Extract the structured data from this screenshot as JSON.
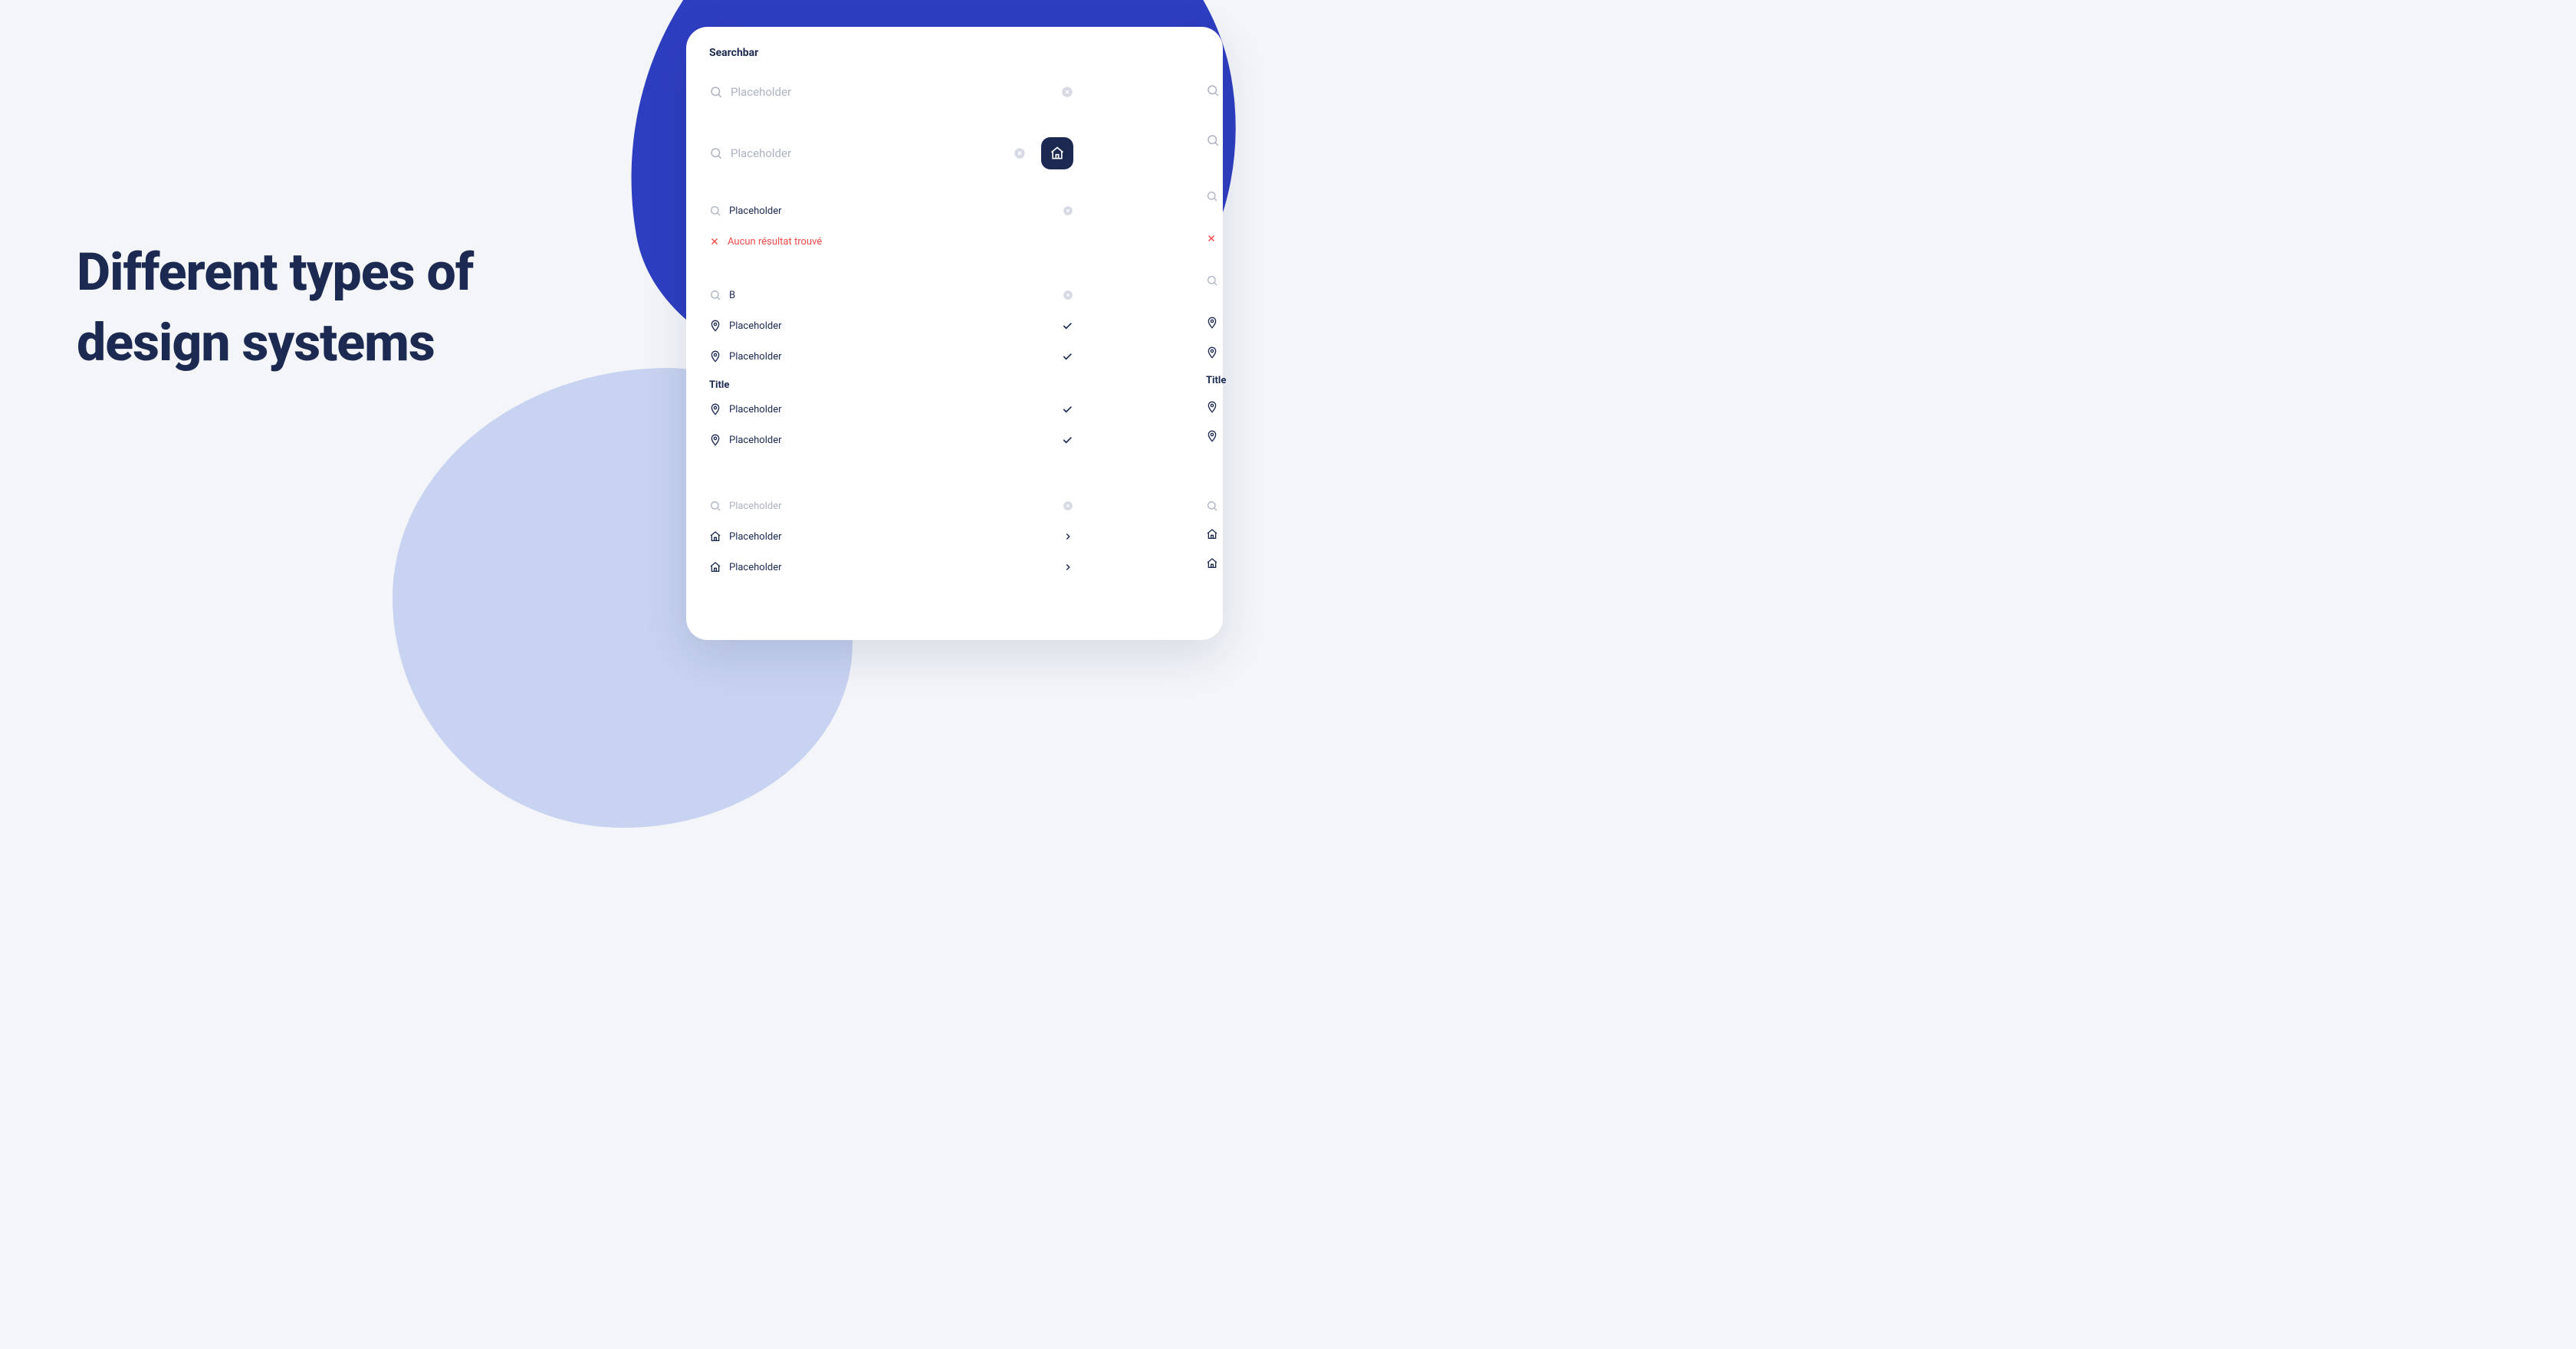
{
  "headline": "Different types of design systems",
  "panel": {
    "title": "Searchbar",
    "searchA": {
      "placeholder": "Placeholder"
    },
    "searchB": {
      "placeholder": "Placeholder"
    },
    "searchC": {
      "value": "Placeholder",
      "error": "Aucun résultat trouvé"
    },
    "searchD": {
      "value": "B",
      "results": [
        "Placeholder",
        "Placeholder"
      ],
      "group": {
        "title": "Title",
        "items": [
          "Placeholder",
          "Placeholder"
        ]
      }
    },
    "searchE": {
      "placeholder": "Placeholder",
      "items": [
        "Placeholder",
        "Placeholder"
      ]
    },
    "rightGroupTitle": "Title"
  },
  "colors": {
    "accent": "#2E3EC1",
    "dark": "#1C2A52",
    "muted": "#ADB3C2",
    "error": "#F04A4A",
    "lightBlob": "#C7D3F0"
  }
}
